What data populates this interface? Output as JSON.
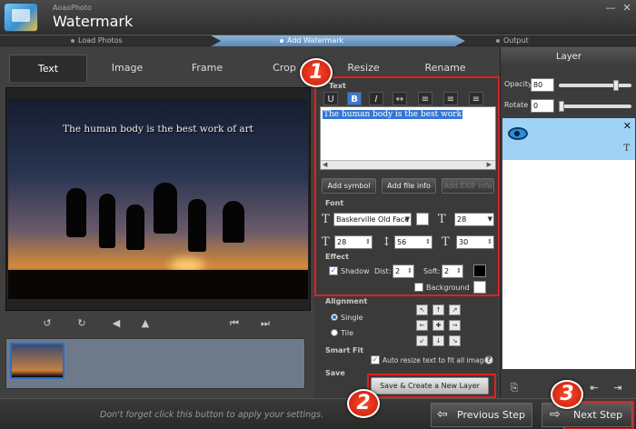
{
  "app": {
    "subtitle": "AoaoPhoto",
    "title": "Watermark"
  },
  "steps": [
    {
      "label": "Load Photos"
    },
    {
      "label": "Add Watermark"
    },
    {
      "label": "Output"
    }
  ],
  "tabs": [
    {
      "label": "Text",
      "active": true
    },
    {
      "label": "Image"
    },
    {
      "label": "Frame"
    },
    {
      "label": "Crop"
    },
    {
      "label": "Resize"
    },
    {
      "label": "Rename"
    }
  ],
  "preview": {
    "watermark_text": "The human body is the best work of art"
  },
  "text_section": {
    "title": "Text",
    "content": "The human body is the best work",
    "add_symbol": "Add symbol",
    "add_file_info": "Add file info",
    "add_exif_info": "Add EXIF info"
  },
  "font_section": {
    "title": "Font",
    "font_name": "Baskerville Old Face",
    "size": "28",
    "char_spacing": "28",
    "line_height": "56",
    "width_scale": "30"
  },
  "effect_section": {
    "title": "Effect",
    "shadow_label": "Shadow",
    "dist_label": "Dist:",
    "dist_value": "2",
    "soft_label": "Soft:",
    "soft_value": "2",
    "background_label": "Background"
  },
  "alignment_section": {
    "title": "Alignment",
    "single_label": "Single",
    "tile_label": "Tile"
  },
  "smartfit_section": {
    "title": "Smart Fit",
    "auto_resize_label": "Auto resize text to fit all images."
  },
  "save_section": {
    "title": "Save",
    "save_button": "Save & Create a New Layer"
  },
  "layer_panel": {
    "title": "Layer",
    "opacity_label": "Opacity",
    "opacity_value": "80",
    "rotate_label": "Rotate",
    "rotate_value": "0"
  },
  "bottom": {
    "hint": "Don't forget click this button to apply your settings.",
    "previous_step": "Previous Step",
    "next_step": "Next Step"
  },
  "badges": [
    "1",
    "2",
    "3"
  ],
  "colors": {
    "accent": "#3a7ad8",
    "highlight": "#e02020",
    "layer_selected": "#9fd2f5"
  }
}
